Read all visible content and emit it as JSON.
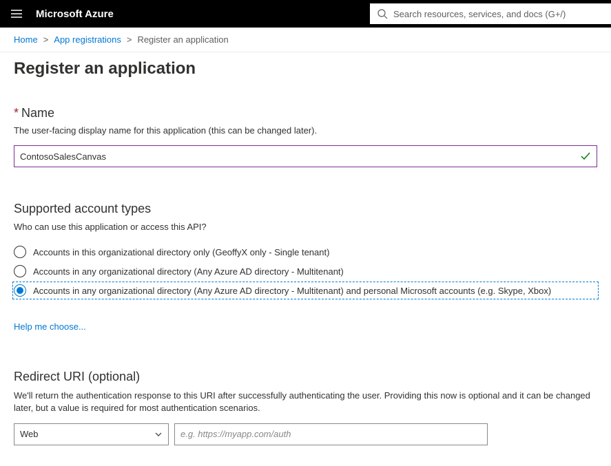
{
  "topbar": {
    "brand": "Microsoft Azure",
    "search_placeholder": "Search resources, services, and docs (G+/)"
  },
  "breadcrumb": {
    "home": "Home",
    "app_reg": "App registrations",
    "current": "Register an application"
  },
  "page_title": "Register an application",
  "name_section": {
    "label": "Name",
    "desc": "The user-facing display name for this application (this can be changed later).",
    "value": "ContosoSalesCanvas"
  },
  "account_types": {
    "heading": "Supported account types",
    "desc": "Who can use this application or access this API?",
    "options": [
      "Accounts in this organizational directory only (GeoffyX only - Single tenant)",
      "Accounts in any organizational directory (Any Azure AD directory - Multitenant)",
      "Accounts in any organizational directory (Any Azure AD directory - Multitenant) and personal Microsoft accounts (e.g. Skype, Xbox)"
    ],
    "help_link": "Help me choose..."
  },
  "redirect": {
    "heading": "Redirect URI (optional)",
    "desc": "We'll return the authentication response to this URI after successfully authenticating the user. Providing this now is optional and it can be changed later, but a value is required for most authentication scenarios.",
    "dropdown_value": "Web",
    "uri_placeholder": "e.g. https://myapp.com/auth"
  }
}
